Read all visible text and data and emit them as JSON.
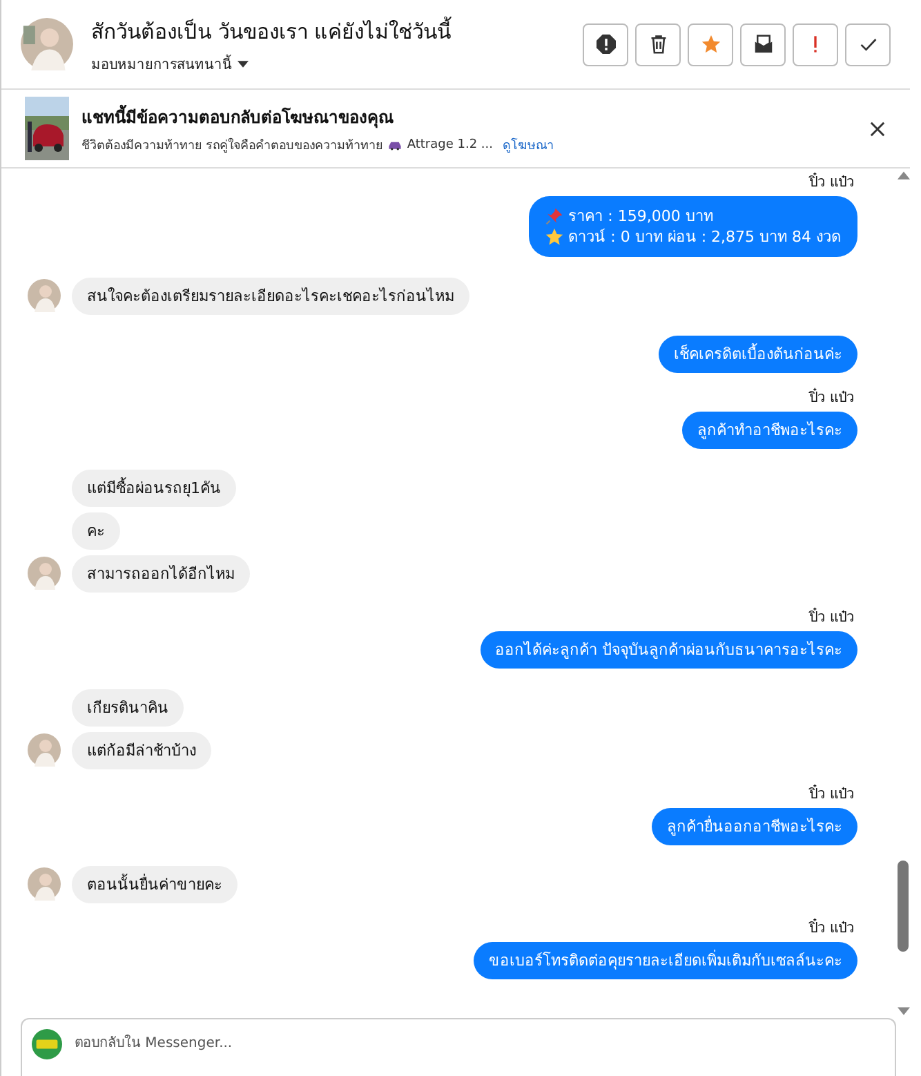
{
  "header": {
    "title": "สักวันต้องเป็น วันของเรา แค่ยังไม่ใช่วันนี้",
    "assign_label": "มอบหมายการสนทนานี้"
  },
  "ad_banner": {
    "heading": "แชทนี้มีข้อความตอบกลับต่อโฆษณาของคุณ",
    "description": "ชีวิตต้องมีความท้าทาย รถคู่ใจคือคำตอบของความท้าทาย",
    "description_tail": "Attrage 1.2 ...",
    "link": "ดูโฆษณา"
  },
  "messages": [
    {
      "kind": "outgoing",
      "sender": "ปิ๋ว แป๋ว",
      "lines": [
        {
          "kind": "pin",
          "text": "ราคา : 159,000 บาท"
        },
        {
          "kind": "star",
          "text": "ดาวน์ : 0 บาท ผ่อน : 2,875 บาท 84 งวด"
        }
      ]
    },
    {
      "kind": "incoming",
      "avatar": true,
      "text": "สนใจคะต้องเตรียมรายละเอียดอะไรคะเชคอะไรก่อนไหม"
    },
    {
      "kind": "outgoing",
      "text": "เช็คเครดิตเบื้องต้นก่อนค่ะ"
    },
    {
      "kind": "outgoing",
      "sender": "ปิ๋ว แป๋ว",
      "text": "ลูกค้าทำอาชีพอะไรคะ"
    },
    {
      "kind": "incoming",
      "avatar": false,
      "text": "แต่มีซื้อผ่อนรถยุ1คัน"
    },
    {
      "kind": "incoming",
      "avatar": false,
      "text": "คะ"
    },
    {
      "kind": "incoming",
      "avatar": true,
      "text": "สามารถออกได้อีกไหม"
    },
    {
      "kind": "outgoing",
      "sender": "ปิ๋ว แป๋ว",
      "text": "ออกได้ค่ะลูกค้า  ปัจจุบันลูกค้าผ่อนกับธนาคารอะไรคะ"
    },
    {
      "kind": "incoming",
      "avatar": false,
      "text": "เกียรตินาคิน"
    },
    {
      "kind": "incoming",
      "avatar": true,
      "text": "แต่ก้อมีล่าช้าบ้าง"
    },
    {
      "kind": "outgoing",
      "sender": "ปิ๋ว แป๋ว",
      "text": "ลูกค้ายื่นออกอาชีพอะไรคะ"
    },
    {
      "kind": "incoming",
      "avatar": true,
      "text": "ตอนนั้นยื่นค่าขายคะ"
    },
    {
      "kind": "outgoing",
      "sender": "ปิ๋ว แป๋ว",
      "text": "ขอเบอร์โทรติดต่อคุยรายละเอียดเพิ่มเติมกับเซลล์นะคะ"
    }
  ],
  "composer": {
    "placeholder": "ตอบกลับใน Messenger..."
  }
}
